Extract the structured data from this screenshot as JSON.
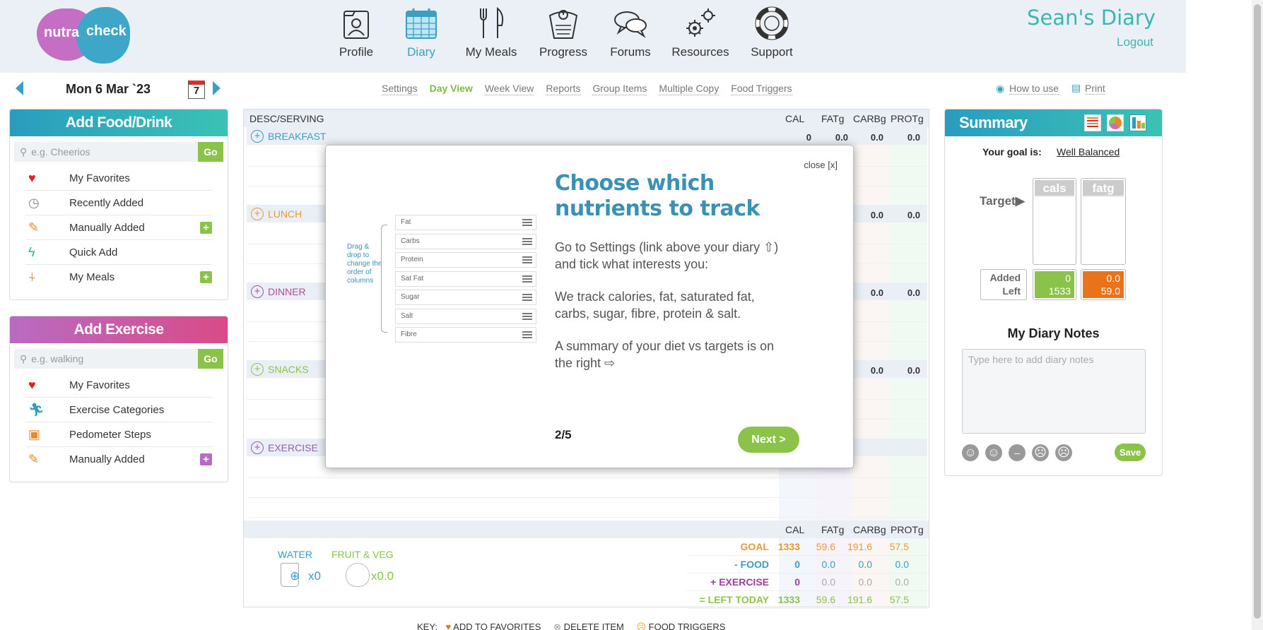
{
  "header": {
    "logo_text_1": "nutra",
    "logo_text_2": "check",
    "nav": [
      {
        "label": "Profile",
        "icon": "profile-icon"
      },
      {
        "label": "Diary",
        "icon": "calendar-icon"
      },
      {
        "label": "My Meals",
        "icon": "cutlery-icon"
      },
      {
        "label": "Progress",
        "icon": "scale-icon"
      },
      {
        "label": "Forums",
        "icon": "speech-bubbles-icon"
      },
      {
        "label": "Resources",
        "icon": "gears-icon"
      },
      {
        "label": "Support",
        "icon": "lifebuoy-icon"
      }
    ],
    "diary_name": "Sean's Diary",
    "logout": "Logout",
    "accent_teal": "#3bb7b0",
    "accent_blue": "#3a9fc2"
  },
  "datebar": {
    "date": "Mon 6 Mar `23",
    "calendar_day": "7",
    "links": [
      "Settings",
      "Day View",
      "Week View",
      "Reports",
      "Group Items",
      "Multiple Copy",
      "Food Triggers"
    ],
    "how_to_use": "How to use",
    "print": "Print"
  },
  "add_food": {
    "title": "Add Food/Drink",
    "placeholder": "e.g. Cheerios",
    "go": "Go",
    "items": [
      {
        "label": "My Favorites",
        "icon": "heart-icon",
        "plus": false
      },
      {
        "label": "Recently Added",
        "icon": "clock-icon",
        "plus": false
      },
      {
        "label": "Manually Added",
        "icon": "pencil-icon",
        "plus": true
      },
      {
        "label": "Quick Add",
        "icon": "lightning-icon",
        "plus": false
      },
      {
        "label": "My Meals",
        "icon": "cutlery-icon",
        "plus": true
      }
    ]
  },
  "add_exercise": {
    "title": "Add Exercise",
    "placeholder": "e.g. walking",
    "go": "Go",
    "items": [
      {
        "label": "My Favorites",
        "icon": "heart-icon",
        "plus": false
      },
      {
        "label": "Exercise Categories",
        "icon": "runner-icon",
        "plus": false
      },
      {
        "label": "Pedometer Steps",
        "icon": "pedometer-icon",
        "plus": false
      },
      {
        "label": "Manually Added",
        "icon": "pencil-icon",
        "plus": true
      }
    ]
  },
  "diary": {
    "columns": [
      "DESC/SERVING",
      "CAL",
      "FATg",
      "CARBg",
      "PROTg"
    ],
    "meals": [
      {
        "name": "BREAKFAST",
        "color": "#3a9fc2",
        "values": [
          "0",
          "0.0",
          "0.0",
          "0.0"
        ]
      },
      {
        "name": "LUNCH",
        "color": "#e59a35",
        "values": [
          "",
          "",
          "0.0",
          "0.0"
        ]
      },
      {
        "name": "DINNER",
        "color": "#b0508f",
        "values": [
          "",
          "",
          "0.0",
          "0.0"
        ]
      },
      {
        "name": "SNACKS",
        "color": "#8bc34a",
        "values": [
          "",
          "",
          "0.0",
          "0.0"
        ]
      },
      {
        "name": "EXERCISE",
        "color": "#9b59b6",
        "values": [
          "",
          "",
          "",
          ""
        ]
      }
    ],
    "bottom_columns": [
      "CAL",
      "FATg",
      "CARBg",
      "PROTg"
    ],
    "water_label": "WATER",
    "water_count": "x0",
    "fruitveg_label": "FRUIT & VEG",
    "fruitveg_count": "x0.0",
    "totals": [
      {
        "label": "GOAL",
        "color": "#e59a35",
        "values": [
          "1333",
          "59.6",
          "191.6",
          "57.5"
        ]
      },
      {
        "label": "- FOOD",
        "color": "#3a9fc2",
        "values": [
          "0",
          "0.0",
          "0.0",
          "0.0"
        ]
      },
      {
        "label": "+ EXERCISE",
        "color": "#9b3f9b",
        "values": [
          "0",
          "0.0",
          "0.0",
          "0.0"
        ]
      },
      {
        "label": "= LEFT TODAY",
        "color": "#8bc34a",
        "values": [
          "1333",
          "59.6",
          "191.6",
          "57.5"
        ]
      }
    ]
  },
  "modal": {
    "close": "close [x]",
    "title": "Choose which nutrients to track",
    "para1": "Go to Settings (link above your diary ⇧) and tick what interests you:",
    "para2": "We track calories, fat, saturated fat, carbs, sugar, fibre, protein & salt.",
    "para3": "A summary of your diet vs targets is on the right ⇨",
    "drag_hint": "Drag & drop to change the order of columns",
    "nutrient_list": [
      "Fat",
      "Carbs",
      "Protein",
      "Sat Fat",
      "Sugar",
      "Salt",
      "Fibre"
    ],
    "step": "2/5",
    "next": "Next >"
  },
  "summary": {
    "title": "Summary",
    "goal_label": "Your goal is:",
    "goal_value": "Well Balanced",
    "target_label": "Target▶",
    "col1": "cals",
    "col2": "fatg",
    "added_label": "Added",
    "left_label": "Left",
    "cals_added": "0",
    "cals_left": "1533",
    "fat_added": "0.0",
    "fat_left": "59.0",
    "notes_title": "My Diary Notes",
    "notes_placeholder": "Type here to add diary notes",
    "save": "Save"
  },
  "footer": {
    "key": "KEY:",
    "fav": "ADD TO FAVORITES",
    "del": "DELETE ITEM",
    "trig": "FOOD TRIGGERS"
  }
}
